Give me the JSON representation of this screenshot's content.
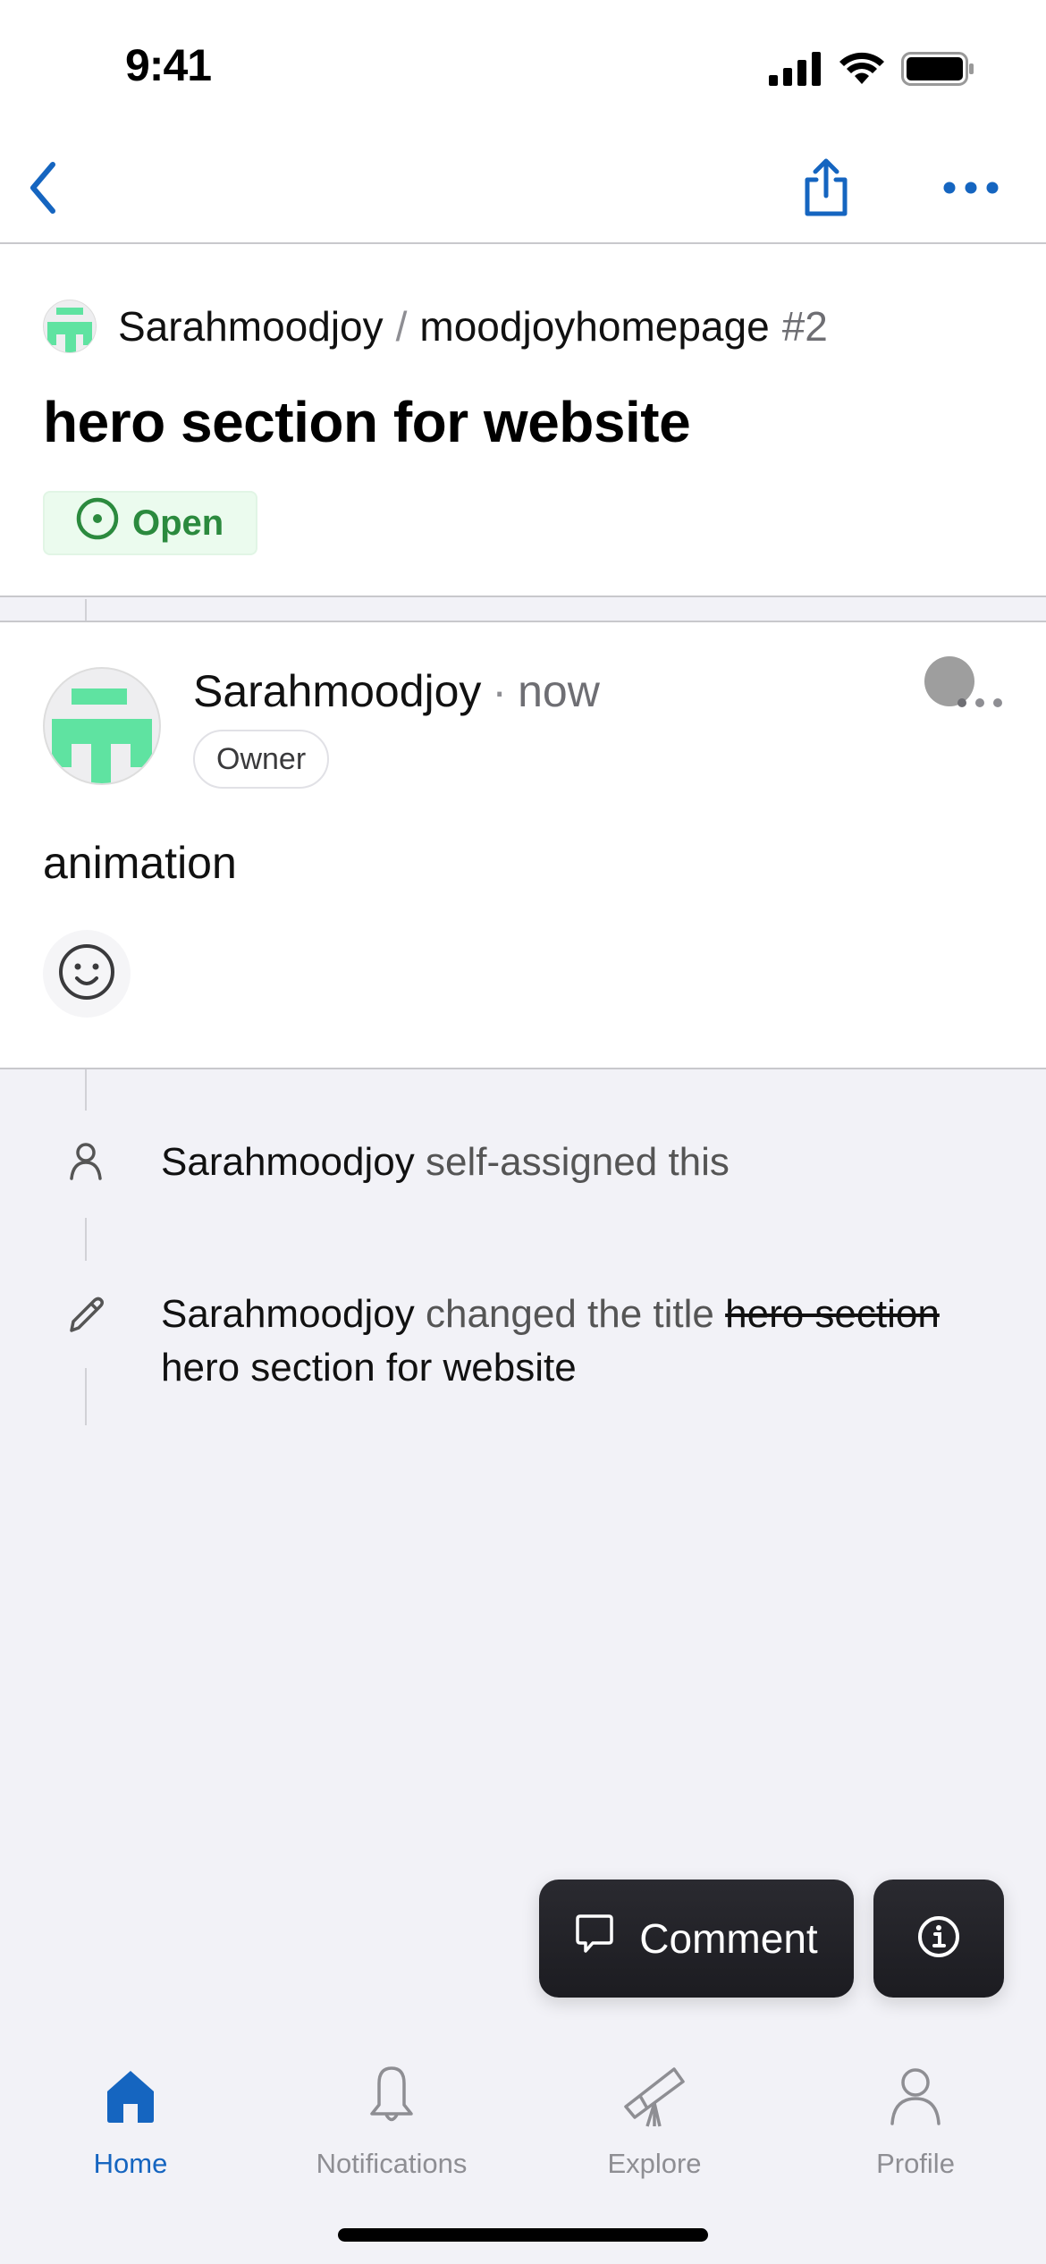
{
  "status_bar": {
    "time": "9:41",
    "icons": [
      "cellular-signal-icon",
      "wifi-icon",
      "battery-icon"
    ]
  },
  "nav_bar": {
    "back_icon": "chevron-left-icon",
    "share_icon": "share-icon",
    "more_icon": "ellipsis-icon",
    "accent_color": "#1565c0"
  },
  "issue": {
    "repo_owner": "Sarahmoodjoy",
    "repo_separator": "/",
    "repo_name": "moodjoyhomepage",
    "number": "#2",
    "title": "hero section for website",
    "state": "Open",
    "state_color": "#2b8a3e",
    "state_bg": "#ebfbee"
  },
  "comment": {
    "author": "Sarahmoodjoy",
    "separator": "·",
    "time": "now",
    "role": "Owner",
    "body": "animation",
    "reaction_icon": "smiley-icon",
    "more_icon": "ellipsis-icon"
  },
  "timeline": [
    {
      "icon": "person-icon",
      "actor": "Sarahmoodjoy",
      "action": "self-assigned this"
    },
    {
      "icon": "pencil-icon",
      "actor": "Sarahmoodjoy",
      "action": "changed the title",
      "old_title": "hero section",
      "new_title": "hero section for website"
    }
  ],
  "actions": {
    "comment_label": "Comment",
    "comment_icon": "comment-icon",
    "info_icon": "info-icon"
  },
  "tab_bar": {
    "active": "Home",
    "tabs": [
      {
        "label": "Home",
        "icon": "home-icon"
      },
      {
        "label": "Notifications",
        "icon": "bell-icon"
      },
      {
        "label": "Explore",
        "icon": "telescope-icon"
      },
      {
        "label": "Profile",
        "icon": "person-icon"
      }
    ]
  }
}
